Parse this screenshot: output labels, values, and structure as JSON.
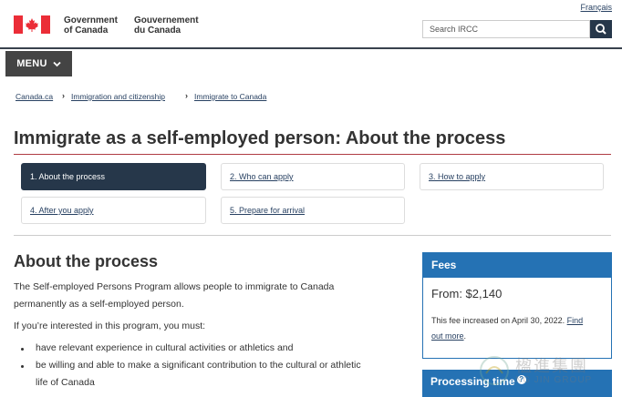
{
  "header": {
    "lang_link": "Français",
    "gov_en_1": "Government",
    "gov_en_2": "of Canada",
    "gov_fr_1": "Gouvernement",
    "gov_fr_2": "du Canada",
    "search_placeholder": "Search IRCC",
    "menu_label": "MENU"
  },
  "breadcrumb": [
    "Canada.ca",
    "Immigration and citizenship",
    "Immigrate to Canada"
  ],
  "page_title": "Immigrate as a self-employed person: About the process",
  "steps": [
    "1. About the process",
    "2. Who can apply",
    "3. How to apply",
    "4. After you apply",
    "5. Prepare for arrival"
  ],
  "main": {
    "heading": "About the process",
    "para1_line1": "The Self-employed Persons Program allows people to immigrate to Canada",
    "para1_line2": "permanently as a self-employed person.",
    "para2": "If you’re interested in this program, you must:",
    "bullet1": "have relevant experience in cultural activities or athletics and",
    "bullet2_line1": "be willing and able to make a significant contribution to the cultural or athletic",
    "bullet2_line2": "life of Canada"
  },
  "fees": {
    "heading": "Fees",
    "amount": "From: $2,140",
    "note": "This fee increased on April 30, 2022.",
    "link1": "Find",
    "link2": "out more",
    "period": "."
  },
  "processing": {
    "heading": "Processing time"
  },
  "watermark": {
    "cn": "楹進集團",
    "en": "NG JIN GROUP"
  },
  "colors": {
    "primary_dark": "#26374a",
    "panel_blue": "#2572b4",
    "title_rule": "#af3c43",
    "flag_red": "#eb2d37",
    "link": "#284162"
  }
}
